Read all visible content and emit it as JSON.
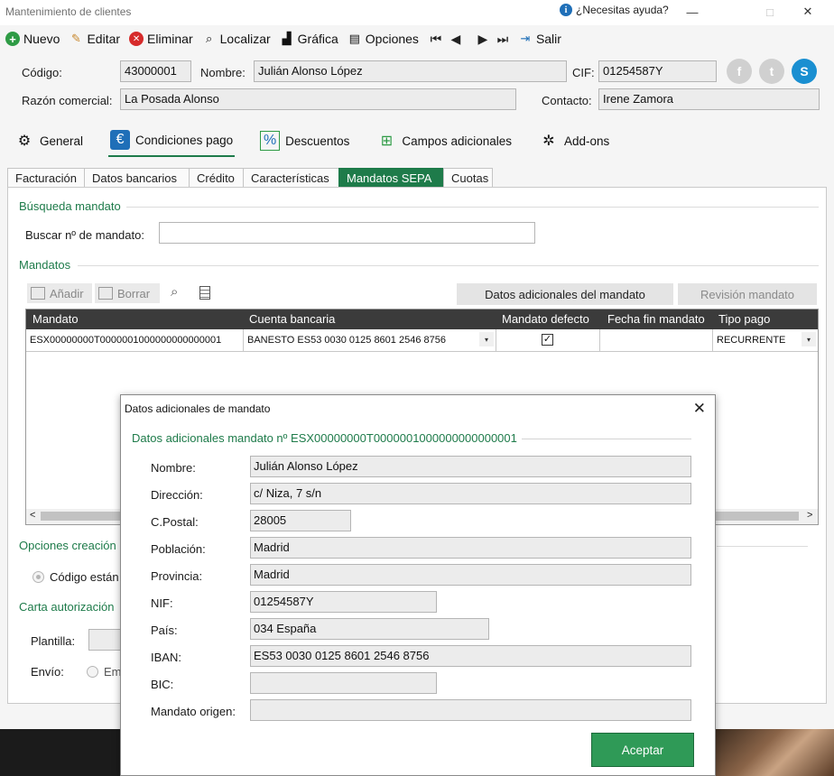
{
  "window": {
    "title": "Mantenimiento de clientes",
    "help_label": "¿Necesitas ayuda?",
    "help_icon_text": "i",
    "minimize": "—",
    "maximize": "□",
    "close": "✕"
  },
  "toolbar": {
    "items": [
      {
        "label": "Nuevo",
        "icon": "plus-circle-icon",
        "glyph": "+",
        "color": "#2e9b45"
      },
      {
        "label": "Editar",
        "icon": "edit-icon",
        "glyph": "✎",
        "color": "#c7862a"
      },
      {
        "label": "Eliminar",
        "icon": "delete-icon",
        "glyph": "✕",
        "color": "#d62b2b"
      },
      {
        "label": "Localizar",
        "icon": "search-icon",
        "glyph": "⌕",
        "color": "#333333"
      },
      {
        "label": "Gráfica",
        "icon": "chart-icon",
        "glyph": "▟",
        "color": "#333333"
      },
      {
        "label": "Opciones",
        "icon": "options-icon",
        "glyph": "▤",
        "color": "#333333"
      }
    ],
    "nav": {
      "first": "⏮",
      "prev": "◀",
      "next": "▶",
      "last": "⏭"
    },
    "exit": {
      "label": "Salir",
      "glyph": "⇥"
    }
  },
  "customer": {
    "code_label": "Código:",
    "code": "43000001",
    "name_label": "Nombre:",
    "name": "Julián Alonso López",
    "cif_label": "CIF:",
    "cif": "01254587Y",
    "trade_label": "Razón comercial:",
    "trade_name": "La Posada Alonso",
    "contact_label": "Contacto:",
    "contact": "Irene Zamora",
    "social": {
      "facebook": "f",
      "twitter": "t",
      "skype": "S"
    }
  },
  "section_tabs": [
    {
      "label": "General",
      "icon": "gears-icon",
      "glyph": "⚙"
    },
    {
      "label": "Condiciones pago",
      "icon": "euro-icon",
      "glyph": "€"
    },
    {
      "label": "Descuentos",
      "icon": "percent-icon",
      "glyph": "%"
    },
    {
      "label": "Campos adicionales",
      "icon": "add-fields-icon",
      "glyph": "⊞"
    },
    {
      "label": "Add-ons",
      "icon": "addons-icon",
      "glyph": "✲"
    }
  ],
  "sub_tabs": [
    "Facturación",
    "Datos bancarios",
    "Crédito",
    "Características",
    "Mandatos SEPA",
    "Cuotas"
  ],
  "search": {
    "title": "Búsqueda mandato",
    "label": "Buscar nº de mandato:",
    "value": ""
  },
  "mandates": {
    "title": "Mandatos",
    "add_label": "Añadir",
    "delete_label": "Borrar",
    "extra_data_button": "Datos adicionales del mandato",
    "review_button": "Revisión mandato",
    "columns": [
      "Mandato",
      "Cuenta bancaria",
      "Mandato defecto",
      "Fecha fin mandato",
      "Tipo pago"
    ],
    "rows": [
      {
        "mandate": "ESX00000000T0000001000000000000001",
        "account": "BANESTO ES53 0030 0125 8601 2546 8756",
        "default": "✓",
        "end_date": "",
        "payment_type": "RECURRENTE"
      }
    ],
    "dropdown_glyph": "▾",
    "scroll_left": "<",
    "scroll_right": ">"
  },
  "creation": {
    "title": "Opciones creación",
    "option_label": "Código están"
  },
  "auth_letter": {
    "title": "Carta autorización",
    "template_label": "Plantilla:",
    "send_label": "Envío:",
    "send_option": "Em"
  },
  "dialog": {
    "title": "Datos adicionales de mandato",
    "close": "✕",
    "subtitle": "Datos adicionales mandato nº ESX00000000T0000001000000000000001",
    "fields": {
      "name": {
        "label": "Nombre:",
        "value": "Julián Alonso López"
      },
      "address": {
        "label": "Dirección:",
        "value": "c/ Niza, 7 s/n"
      },
      "postal": {
        "label": "C.Postal:",
        "value": "28005"
      },
      "city": {
        "label": "Población:",
        "value": "Madrid"
      },
      "province": {
        "label": "Provincia:",
        "value": "Madrid"
      },
      "nif": {
        "label": "NIF:",
        "value": "01254587Y"
      },
      "country": {
        "label": "País:",
        "value": "034 España"
      },
      "iban": {
        "label": "IBAN:",
        "value": "ES53 0030 0125 8601 2546 8756"
      },
      "bic": {
        "label": "BIC:",
        "value": ""
      },
      "origin": {
        "label": "Mandato origen:",
        "value": ""
      }
    },
    "accept": "Aceptar"
  },
  "colors": {
    "accent": "#1e7b4a",
    "accept": "#2f9a57",
    "header": "#3b3b3b",
    "facebook": "#cfcfcf",
    "skype": "#1a8fd1"
  }
}
